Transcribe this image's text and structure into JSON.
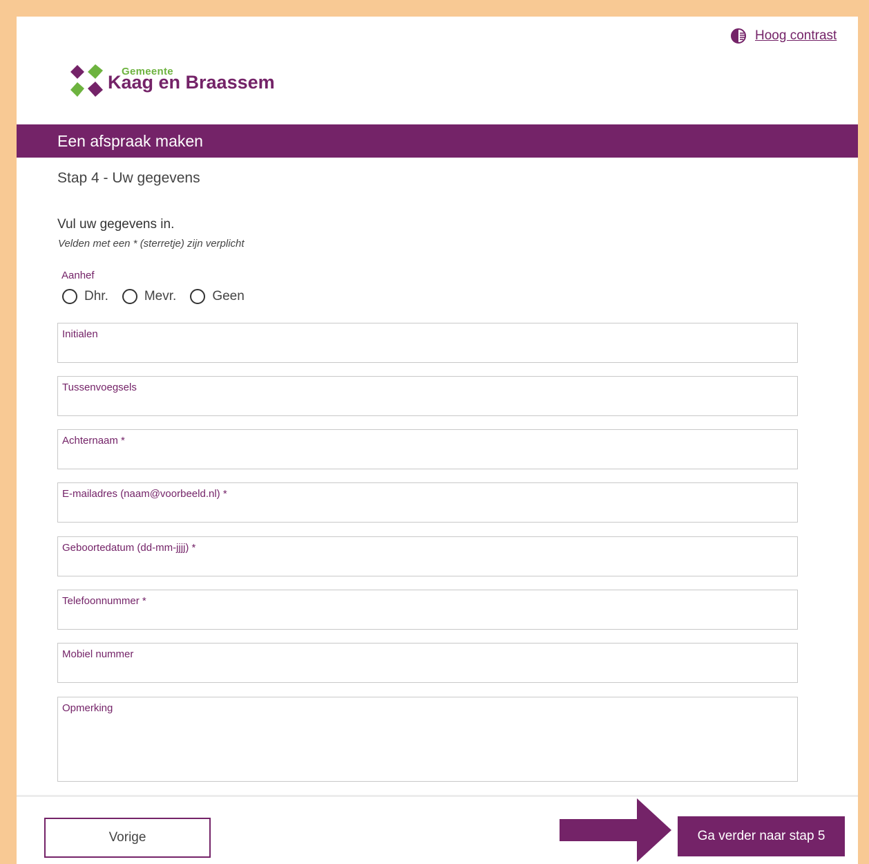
{
  "header": {
    "contrast_label": "Hoog contrast",
    "logo_small": "Gemeente",
    "logo_big": "Kaag en Braassem"
  },
  "colors": {
    "brand": "#742368",
    "accent_green": "#6db33f",
    "frame": "#f8c994"
  },
  "page": {
    "title": "Een afspraak maken",
    "step": "Stap 4 - Uw gegevens",
    "intro": "Vul uw gegevens in.",
    "required_note": "Velden met een * (sterretje) zijn verplicht"
  },
  "form": {
    "salutation": {
      "label": "Aanhef",
      "options": [
        "Dhr.",
        "Mevr.",
        "Geen"
      ]
    },
    "fields": {
      "initials": {
        "label": "Initialen",
        "value": ""
      },
      "infix": {
        "label": "Tussenvoegsels",
        "value": ""
      },
      "surname": {
        "label": "Achternaam *",
        "value": ""
      },
      "email": {
        "label": "E-mailadres (naam@voorbeeld.nl) *",
        "value": ""
      },
      "birthdate": {
        "label": "Geboortedatum (dd-mm-jjjj) *",
        "value": ""
      },
      "phone": {
        "label": "Telefoonnummer *",
        "value": ""
      },
      "mobile": {
        "label": "Mobiel nummer",
        "value": ""
      },
      "remark": {
        "label": "Opmerking",
        "value": ""
      }
    }
  },
  "footer": {
    "prev_label": "Vorige",
    "next_label": "Ga verder naar stap 5"
  }
}
